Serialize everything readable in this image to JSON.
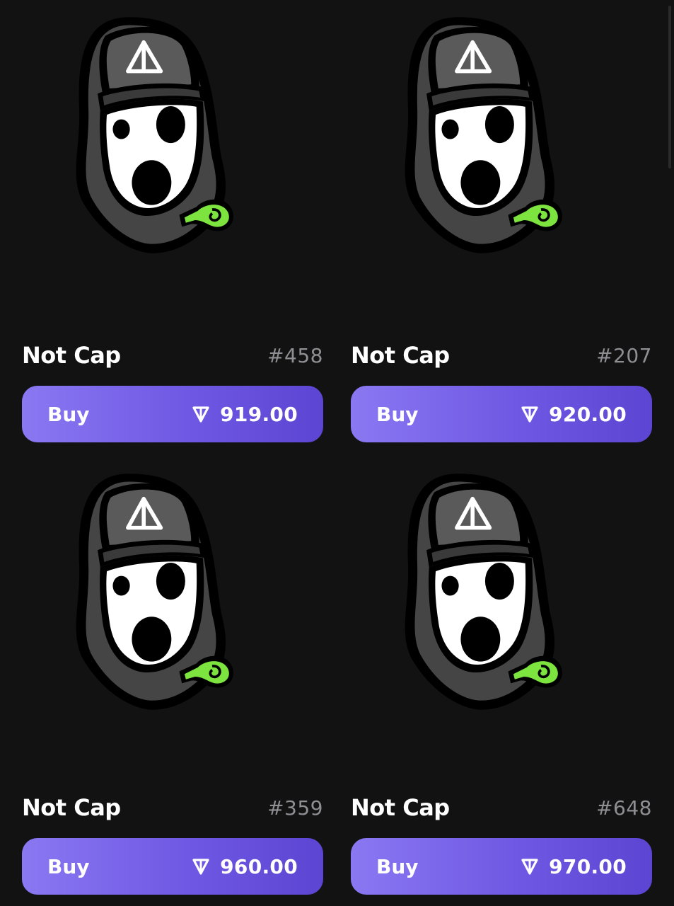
{
  "items": [
    {
      "name": "Not Cap",
      "number": "#458",
      "buy_label": "Buy",
      "price": "919.00",
      "icon": "ton-diamond-icon"
    },
    {
      "name": "Not Cap",
      "number": "#207",
      "buy_label": "Buy",
      "price": "920.00",
      "icon": "ton-diamond-icon"
    },
    {
      "name": "Not Cap",
      "number": "#359",
      "buy_label": "Buy",
      "price": "960.00",
      "icon": "ton-diamond-icon"
    },
    {
      "name": "Not Cap",
      "number": "#648",
      "buy_label": "Buy",
      "price": "970.00",
      "icon": "ton-diamond-icon"
    }
  ],
  "colors": {
    "background": "#121212",
    "button_start": "#8a78f2",
    "button_end": "#5c45d2",
    "accent_green": "#7ce33f",
    "muted_text": "#8e8e93"
  }
}
